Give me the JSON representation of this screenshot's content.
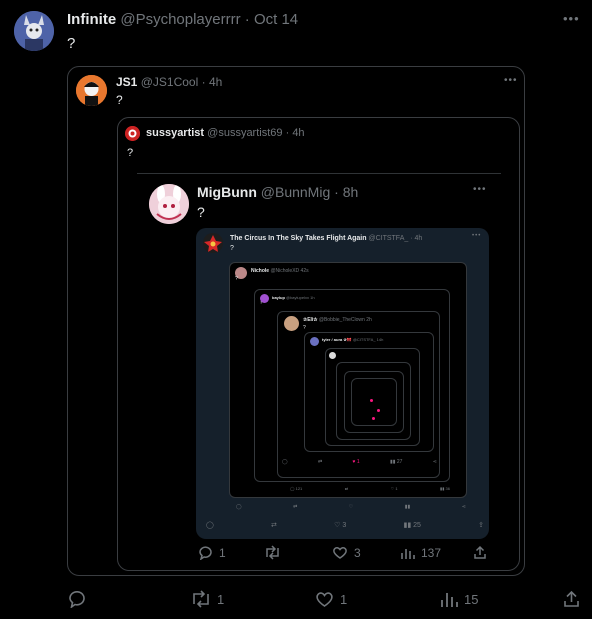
{
  "main_tweet": {
    "name": "Infinite",
    "handle": "@Psychoplayerrrr",
    "sep": "·",
    "time": "Oct 14",
    "text": "?",
    "stats": {
      "replies": "",
      "retweets": "1",
      "likes": "1",
      "views": "15"
    }
  },
  "quote1": {
    "name": "JS1",
    "handle": "@JS1Cool",
    "sep": "·",
    "time": "4h",
    "text": "?"
  },
  "quote2": {
    "name": "sussyartist",
    "handle": "@sussyartist69",
    "sep": "·",
    "time": "4h",
    "text": "?"
  },
  "quote3": {
    "name": "MigBunn",
    "handle": "@BunnMig",
    "sep": "·",
    "time": "8h",
    "text": "?",
    "stats": {
      "replies": "1",
      "retweets": "",
      "likes": "3",
      "views": "137"
    }
  },
  "screenshot": {
    "name": "The Circus In The Sky Takes Flight Again",
    "handle": "@CITSTFA_",
    "sep": "·",
    "time": "4h",
    "text": "?",
    "stats": {
      "likes": "3",
      "views": "25"
    },
    "nested": {
      "nichole": {
        "name": "Nichole",
        "handle": "@NicholeXD",
        "time": "42s",
        "text": "?"
      },
      "baylup": {
        "name": "baylup",
        "handle": "@baylupelxx",
        "time": "1h",
        "text": "?"
      },
      "eli": {
        "name": "✰Eli✰",
        "handle": "@Bobbie_TheClown",
        "time": "2h",
        "text": "?"
      },
      "tyler": {
        "name": "tyler / aura ✰🎀",
        "handle": "@CITSTFA_",
        "time": "14h"
      },
      "inner_stats": {
        "retweets": "",
        "likes": "1",
        "views": "27"
      },
      "deep_stats": {
        "replies": "121",
        "likes": "1",
        "views": "36"
      }
    }
  },
  "colors": {
    "background": "#000000",
    "border": "#2f3336",
    "text": "#e7e9ea",
    "muted": "#71767b",
    "dim_panel": "#15202b",
    "like_pink": "#f91880"
  }
}
